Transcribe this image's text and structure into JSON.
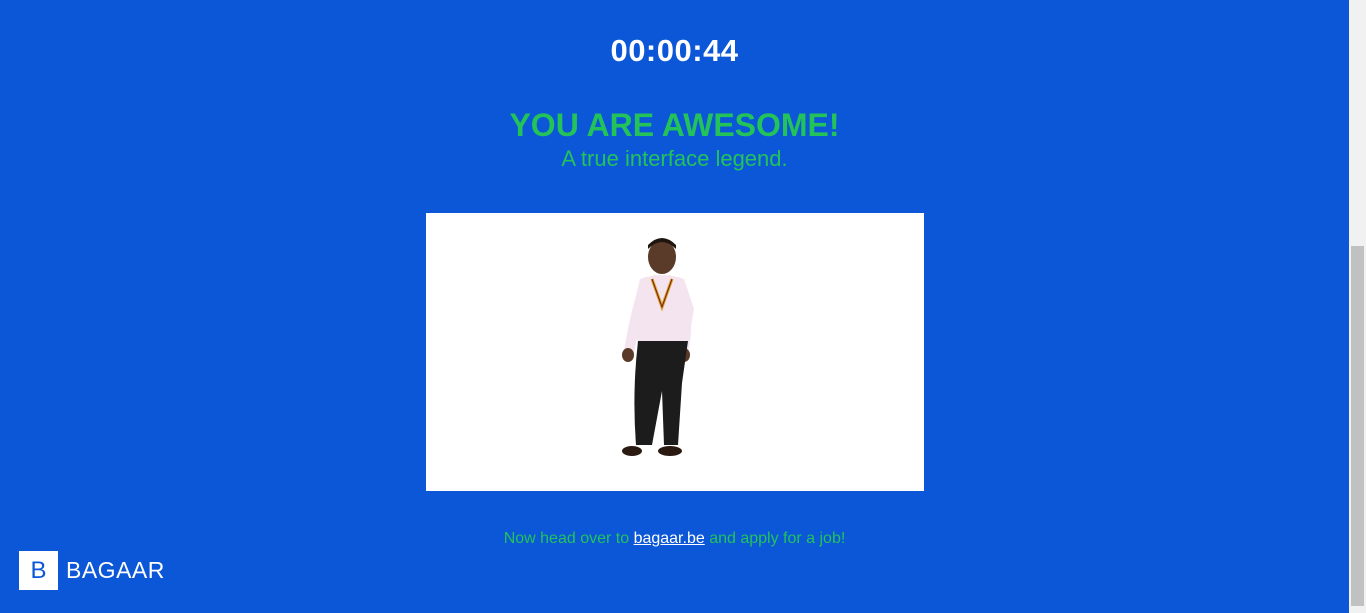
{
  "timer": {
    "value": "00:00:44"
  },
  "message": {
    "headline": "YOU ARE AWESOME!",
    "subline": "A true interface legend."
  },
  "gif": {
    "alt_icon": "dancing-man-image"
  },
  "cta": {
    "prefix": "Now head over to ",
    "link_text": "bagaar.be",
    "suffix": " and apply for a job!"
  },
  "logo": {
    "mark": "B",
    "name": "BAGAAR"
  },
  "colors": {
    "background": "#0b57d8",
    "accent_green": "#23c35a",
    "text_white": "#ffffff"
  }
}
